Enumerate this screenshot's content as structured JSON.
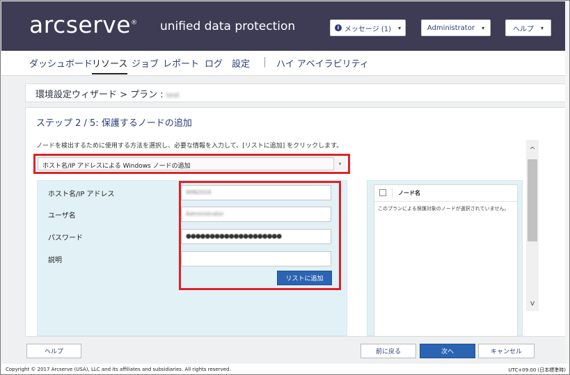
{
  "header": {
    "logo": "arcserve",
    "logo_mark": "®",
    "product": "unified data protection",
    "messages_label": "メッセージ (1)",
    "admin_label": "Administrator",
    "help_label": "ヘルプ",
    "info_glyph": "i",
    "caret_glyph": "▾"
  },
  "nav": {
    "items": [
      {
        "label": "ダッシュボード",
        "active": false
      },
      {
        "label": "リソース",
        "active": true
      },
      {
        "label": "ジョブ",
        "active": false
      },
      {
        "label": "レポート",
        "active": false
      },
      {
        "label": "ログ",
        "active": false
      },
      {
        "label": "設定",
        "active": false
      },
      {
        "label": "ハイ アベイラビリティ",
        "active": false
      }
    ]
  },
  "breadcrumb": {
    "text": "環境設定ウィザード > プラン : ",
    "plan_name": "test"
  },
  "wizard": {
    "step_title": "ステップ 2 / 5: 保護するノードの追加",
    "instruction": "ノードを検出するために使用する方法を選択し、必要な情報を入力して、[リストに追加] をクリックします。",
    "method_selected": "ホスト名/IP アドレスによる Windows ノードの追加",
    "select_arrow": "▾",
    "fields": [
      {
        "label": "ホスト名/IP アドレス",
        "value": "WIN2016"
      },
      {
        "label": "ユーザ名",
        "value": "Administrator"
      },
      {
        "label": "パスワード",
        "value": "●●●●●●●●●●●●●●●●●●●●"
      },
      {
        "label": "説明",
        "value": ""
      }
    ],
    "add_button": "リストに追加",
    "node_list": {
      "column_header": "ノード名",
      "empty_message": "このプランによる保護対象のノードが選択されていません。"
    },
    "scroll_up": "^",
    "scroll_down": "v"
  },
  "footer": {
    "help": "ヘルプ",
    "back": "前に戻る",
    "next": "次へ",
    "cancel": "キャンセル"
  },
  "status": {
    "copyright": "Copyright © 2017 Arcserve (USA), LLC and its affiliates and subsidiaries. All rights reserved.",
    "timezone": "UTC+09:00 (日本標準時)"
  },
  "colors": {
    "header_bg": "#3e3b55",
    "accent_blue": "#2b64b3",
    "highlight_red": "#e0202a",
    "form_bg": "#e1f1f6"
  }
}
